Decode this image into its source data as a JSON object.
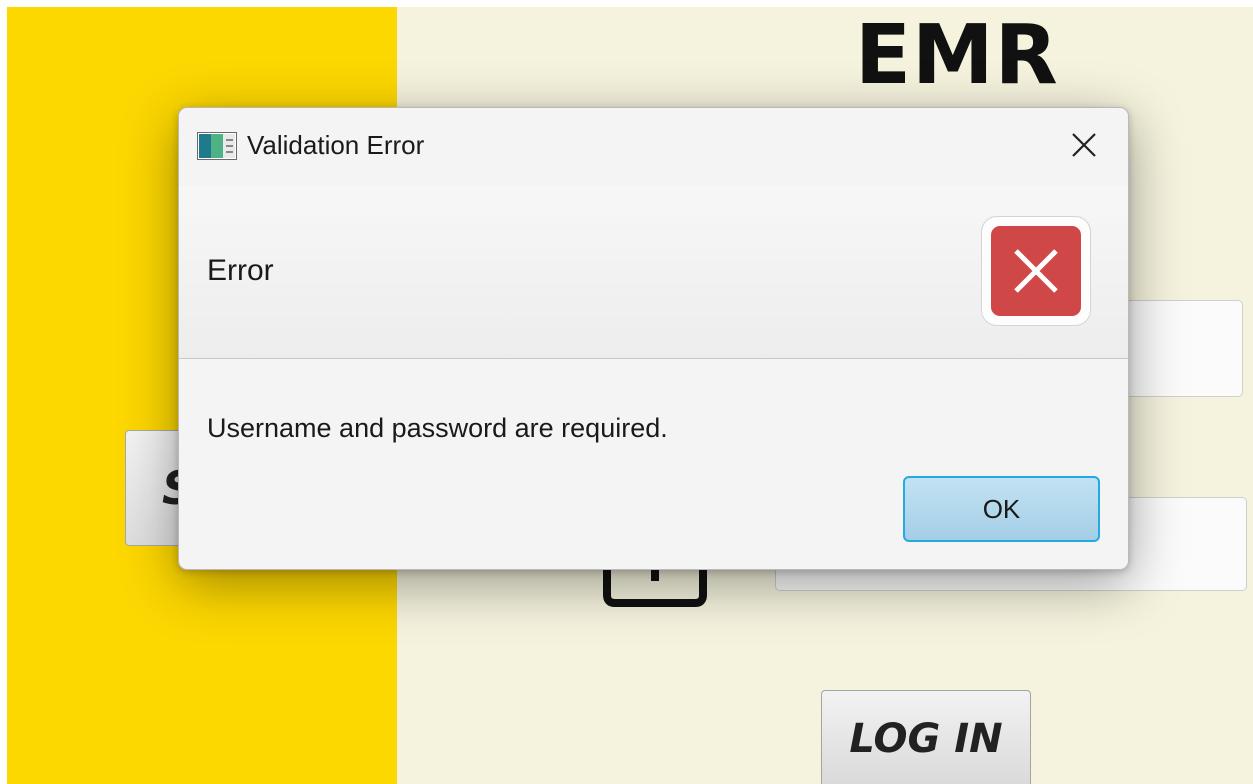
{
  "app": {
    "title": "EMR",
    "side_button_label": "S",
    "login_button_label": "LOG IN"
  },
  "dialog": {
    "title": "Validation Error",
    "header_text": "Error",
    "content_text": "Username and password are required.",
    "ok_label": "OK",
    "icons": {
      "app": "app-window-icon",
      "close": "close-icon",
      "error": "error-x-icon"
    }
  },
  "colors": {
    "left_panel": "#fdd700",
    "right_panel": "#f5f3dd",
    "error_icon": "#cf4747",
    "ok_focus_border": "#27a9e0"
  }
}
